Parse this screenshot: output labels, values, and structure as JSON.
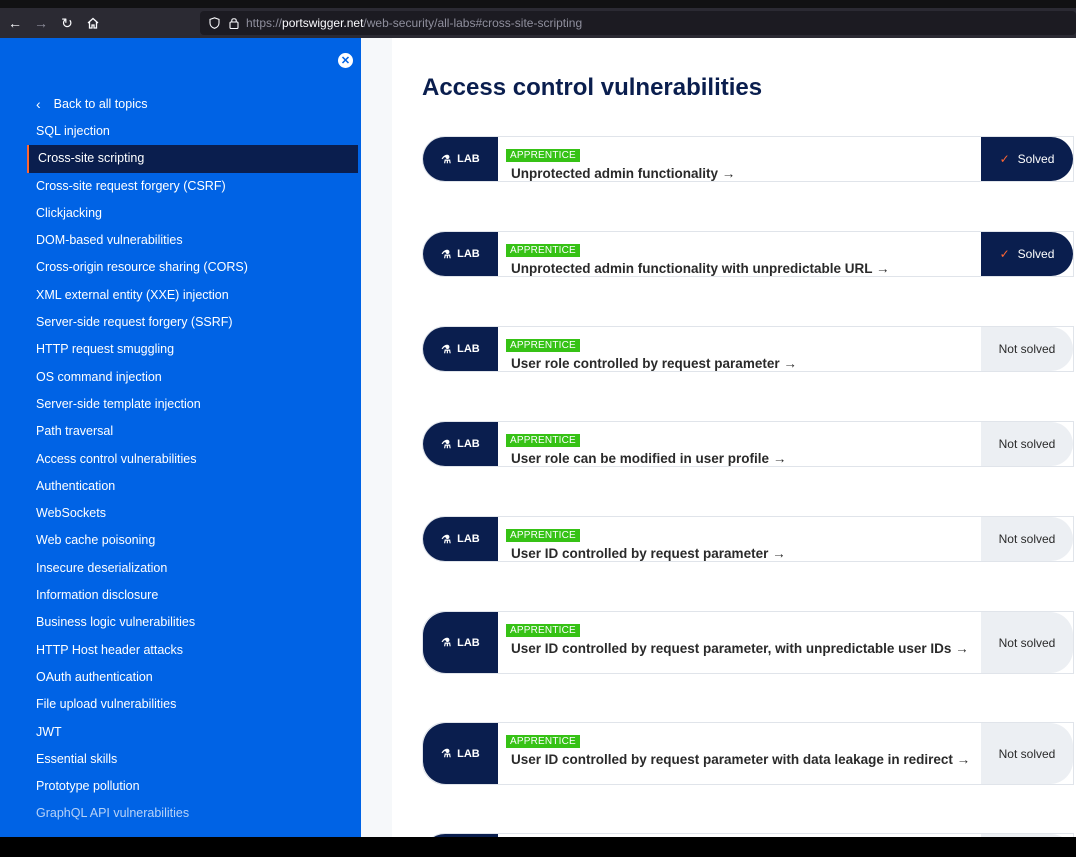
{
  "browser": {
    "url_prefix": "https://",
    "url_host": "portswigger.net",
    "url_path": "/web-security/all-labs#cross-site-scripting"
  },
  "sidebar": {
    "close_symbol": "✕",
    "back_label": "Back to all topics",
    "topics": [
      {
        "label": "SQL injection"
      },
      {
        "label": "Cross-site scripting"
      },
      {
        "label": "Cross-site request forgery (CSRF)"
      },
      {
        "label": "Clickjacking"
      },
      {
        "label": "DOM-based vulnerabilities"
      },
      {
        "label": "Cross-origin resource sharing (CORS)"
      },
      {
        "label": "XML external entity (XXE) injection"
      },
      {
        "label": "Server-side request forgery (SSRF)"
      },
      {
        "label": "HTTP request smuggling"
      },
      {
        "label": "OS command injection"
      },
      {
        "label": "Server-side template injection"
      },
      {
        "label": "Path traversal"
      },
      {
        "label": "Access control vulnerabilities"
      },
      {
        "label": "Authentication"
      },
      {
        "label": "WebSockets"
      },
      {
        "label": "Web cache poisoning"
      },
      {
        "label": "Insecure deserialization"
      },
      {
        "label": "Information disclosure"
      },
      {
        "label": "Business logic vulnerabilities"
      },
      {
        "label": "HTTP Host header attacks"
      },
      {
        "label": "OAuth authentication"
      },
      {
        "label": "File upload vulnerabilities"
      },
      {
        "label": "JWT"
      },
      {
        "label": "Essential skills"
      },
      {
        "label": "Prototype pollution"
      },
      {
        "label": "GraphQL API vulnerabilities"
      }
    ],
    "active_topic": "Cross-site scripting"
  },
  "main": {
    "title": "Access control vulnerabilities",
    "badge_label": "LAB",
    "labs": [
      {
        "level": "APPRENTICE",
        "title": "Unprotected admin functionality →",
        "status": "Solved",
        "solved": true
      },
      {
        "level": "APPRENTICE",
        "title": "Unprotected admin functionality with unpredictable URL →",
        "status": "Solved",
        "solved": true
      },
      {
        "level": "APPRENTICE",
        "title": "User role controlled by request parameter →",
        "status": "Not solved",
        "solved": false
      },
      {
        "level": "APPRENTICE",
        "title": "User role can be modified in user profile →",
        "status": "Not solved",
        "solved": false
      },
      {
        "level": "APPRENTICE",
        "title": "User ID controlled by request parameter  →",
        "status": "Not solved",
        "solved": false
      },
      {
        "level": "APPRENTICE",
        "title": "User ID controlled by request parameter, with unpredictable user IDs →",
        "status": "Not solved",
        "solved": false
      },
      {
        "level": "APPRENTICE",
        "title": "User ID controlled by request parameter with data leakage in redirect →",
        "status": "Not solved",
        "solved": false
      }
    ]
  },
  "colors": {
    "sidebar_bg": "#0063e5",
    "navy": "#0a1e4e",
    "accent_orange": "#ff6633",
    "level_green": "#36c215"
  }
}
